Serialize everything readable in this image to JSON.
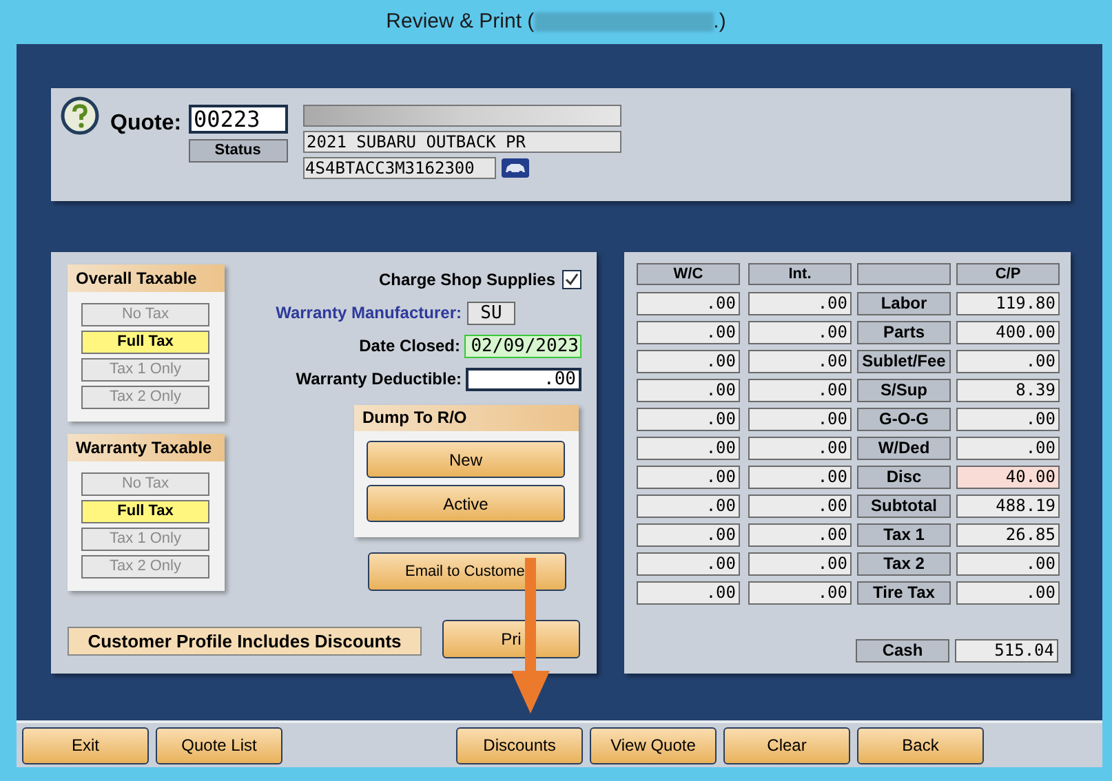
{
  "title": {
    "text": "Review & Print (",
    "suffix": ".)"
  },
  "quote": {
    "label": "Quote:",
    "number": "00223",
    "status": "Status",
    "vehicle": "2021 SUBARU OUTBACK PR",
    "vin": "4S4BTACC3M3162300"
  },
  "tax_groups": [
    {
      "title": "Overall Taxable",
      "options": [
        {
          "label": "No Tax",
          "selected": false
        },
        {
          "label": "Full Tax",
          "selected": true
        },
        {
          "label": "Tax 1 Only",
          "selected": false
        },
        {
          "label": "Tax 2 Only",
          "selected": false
        }
      ]
    },
    {
      "title": "Warranty Taxable",
      "options": [
        {
          "label": "No Tax",
          "selected": false
        },
        {
          "label": "Full Tax",
          "selected": true
        },
        {
          "label": "Tax 1 Only",
          "selected": false
        },
        {
          "label": "Tax 2 Only",
          "selected": false
        }
      ]
    }
  ],
  "charge_shop_supplies": {
    "label": "Charge Shop Supplies",
    "checked": true
  },
  "warranty_manufacturer": {
    "label": "Warranty Manufacturer:",
    "value": "SU"
  },
  "date_closed": {
    "label": "Date Closed:",
    "value": "02/09/2023"
  },
  "warranty_deductible": {
    "label": "Warranty Deductible:",
    "value": ".00"
  },
  "dump_to_ro": {
    "title": "Dump To R/O",
    "buttons": [
      "New",
      "Active"
    ]
  },
  "email_button": "Email to Custome",
  "print_button": "Pri",
  "notice": "Customer Profile Includes Discounts",
  "totals": {
    "headers": {
      "wc": "W/C",
      "int": "Int.",
      "cp": "C/P"
    },
    "rows": [
      {
        "label": "Labor",
        "wc": ".00",
        "int": ".00",
        "cp": "119.80",
        "highlighted": false
      },
      {
        "label": "Parts",
        "wc": ".00",
        "int": ".00",
        "cp": "400.00",
        "highlighted": false
      },
      {
        "label": "Sublet/Fee",
        "wc": ".00",
        "int": ".00",
        "cp": ".00",
        "highlighted": false
      },
      {
        "label": "S/Sup",
        "wc": ".00",
        "int": ".00",
        "cp": "8.39",
        "highlighted": false
      },
      {
        "label": "G-O-G",
        "wc": ".00",
        "int": ".00",
        "cp": ".00",
        "highlighted": false
      },
      {
        "label": "W/Ded",
        "wc": ".00",
        "int": ".00",
        "cp": ".00",
        "highlighted": false
      },
      {
        "label": "Disc",
        "wc": ".00",
        "int": ".00",
        "cp": "40.00",
        "highlighted": true
      },
      {
        "label": "Subtotal",
        "wc": ".00",
        "int": ".00",
        "cp": "488.19",
        "highlighted": false
      },
      {
        "label": "Tax 1",
        "wc": ".00",
        "int": ".00",
        "cp": "26.85",
        "highlighted": false
      },
      {
        "label": "Tax 2",
        "wc": ".00",
        "int": ".00",
        "cp": ".00",
        "highlighted": false
      },
      {
        "label": "Tire Tax",
        "wc": ".00",
        "int": ".00",
        "cp": ".00",
        "highlighted": false
      }
    ],
    "cash": {
      "label": "Cash",
      "value": "515.04"
    }
  },
  "footer": {
    "left": [
      "Exit",
      "Quote List"
    ],
    "right": [
      "Discounts",
      "View Quote",
      "Clear",
      "Back"
    ]
  }
}
